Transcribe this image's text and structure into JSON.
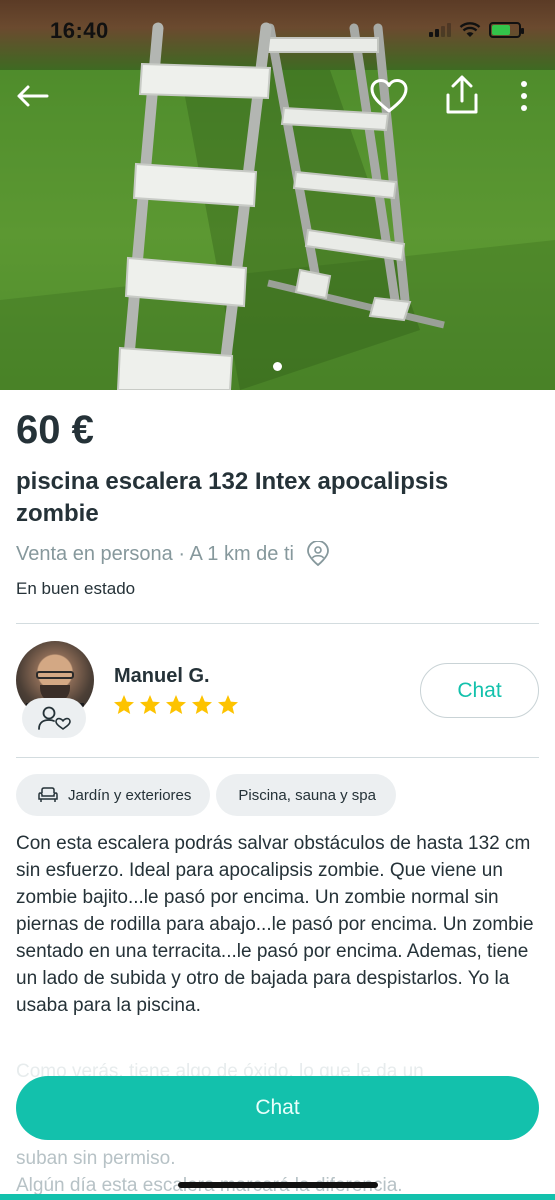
{
  "status_bar": {
    "time": "16:40"
  },
  "gallery": {
    "photo_description": "pool-ladder",
    "image_count": 1,
    "active_index": 1
  },
  "listing": {
    "price": "60 €",
    "title": "piscina escalera 132 Intex apocalipsis zombie",
    "delivery": "Venta en persona · A 1 km de ti",
    "condition": "En buen estado"
  },
  "seller": {
    "name": "Manuel G.",
    "rating": 5,
    "rating_max": 5,
    "chat_label": "Chat"
  },
  "categories": [
    {
      "label": "Jardín y exteriores",
      "icon": "sofa-icon"
    },
    {
      "label": "Piscina, sauna y spa"
    }
  ],
  "description": {
    "visible": "Con esta escalera podrás salvar obstáculos de hasta 132 cm sin esfuerzo. Ideal para apocalipsis zombie. Que viene un zombie bajito...le pasó por encima. Un zombie normal sin piernas de rodilla para abajo...le pasó por encima. Un zombie sentado en una terracita...le pasó por encima. Ademas, tiene un lado de subida y otro de bajada para despistarlos. Yo la usaba para la piscina.",
    "faded_line": "Como verás, tiene algo de óxido, lo que le da un",
    "faded_bottom_1": "suban sin permiso.",
    "faded_bottom_2": "Algún día esta escalera marcará la diferencia."
  },
  "actions": {
    "chat_button": "Chat"
  },
  "colors": {
    "accent": "#13c1ac",
    "text": "#253238",
    "muted": "#86989c",
    "star": "#fdc300",
    "chip_bg": "#eceff1"
  }
}
